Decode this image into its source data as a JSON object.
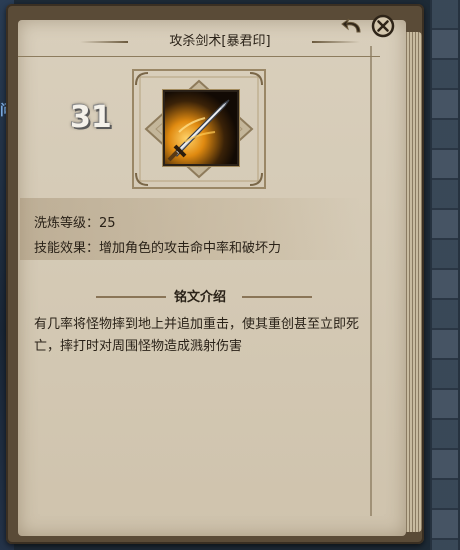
{
  "window": {
    "title": "攻杀剑术[暴君印]"
  },
  "side_fragment": "问题",
  "skill": {
    "level": "31",
    "icon": "sword-slash-icon"
  },
  "attributes": [
    {
      "label": "洗炼等级：25"
    },
    {
      "label": "技能效果：增加角色的攻击命中率和破坏力"
    }
  ],
  "section": {
    "title": "铭文介绍",
    "description": "有几率将怪物摔到地上并追加重击，使其重创甚至立即死亡，摔打时对周围怪物造成溅射伤害"
  },
  "colors": {
    "page": "#d6ccb7",
    "text": "#2a2218",
    "level": "#f4f1ea",
    "icon_glow": "#f0a020"
  }
}
